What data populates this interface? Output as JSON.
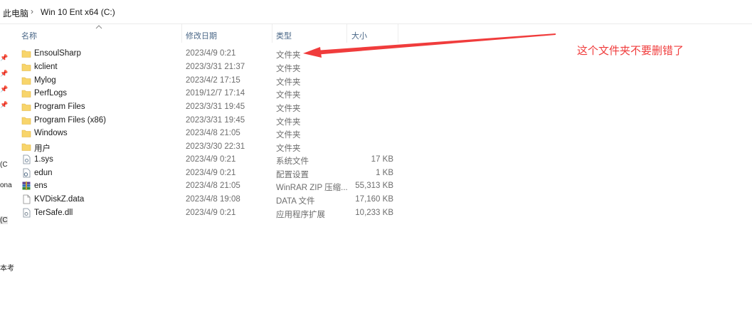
{
  "breadcrumb": {
    "root": "此电脑",
    "separator": "›",
    "current": "Win 10 Ent x64 (C:)"
  },
  "columns": {
    "name": "名称",
    "date": "修改日期",
    "type": "类型",
    "size": "大小"
  },
  "nav_fragments": [
    "(C",
    "ona",
    "(C",
    "本考"
  ],
  "files": [
    {
      "name": "EnsoulSharp",
      "date": "2023/4/9 0:21",
      "type": "文件夹",
      "size": "",
      "icon": "folder-icon"
    },
    {
      "name": "kclient",
      "date": "2023/3/31 21:37",
      "type": "文件夹",
      "size": "",
      "icon": "folder-icon"
    },
    {
      "name": "Mylog",
      "date": "2023/4/2 17:15",
      "type": "文件夹",
      "size": "",
      "icon": "folder-icon"
    },
    {
      "name": "PerfLogs",
      "date": "2019/12/7 17:14",
      "type": "文件夹",
      "size": "",
      "icon": "folder-icon"
    },
    {
      "name": "Program Files",
      "date": "2023/3/31 19:45",
      "type": "文件夹",
      "size": "",
      "icon": "folder-icon"
    },
    {
      "name": "Program Files (x86)",
      "date": "2023/3/31 19:45",
      "type": "文件夹",
      "size": "",
      "icon": "folder-icon"
    },
    {
      "name": "Windows",
      "date": "2023/4/8 21:05",
      "type": "文件夹",
      "size": "",
      "icon": "folder-icon"
    },
    {
      "name": "用户",
      "date": "2023/3/30 22:31",
      "type": "文件夹",
      "size": "",
      "icon": "folder-icon"
    },
    {
      "name": "1.sys",
      "date": "2023/4/9 0:21",
      "type": "系统文件",
      "size": "17 KB",
      "icon": "system-file-icon"
    },
    {
      "name": "edun",
      "date": "2023/4/9 0:21",
      "type": "配置设置",
      "size": "1 KB",
      "icon": "config-file-icon"
    },
    {
      "name": "ens",
      "date": "2023/4/8 21:05",
      "type": "WinRAR ZIP 压缩...",
      "size": "55,313 KB",
      "icon": "winrar-archive-icon"
    },
    {
      "name": "KVDiskZ.data",
      "date": "2023/4/8 19:08",
      "type": "DATA 文件",
      "size": "17,160 KB",
      "icon": "blank-file-icon"
    },
    {
      "name": "TerSafe.dll",
      "date": "2023/4/9 0:21",
      "type": "应用程序扩展",
      "size": "10,233 KB",
      "icon": "dll-file-icon"
    }
  ],
  "annotation": {
    "text": "这个文件夹不要删错了",
    "color": "#f03c3c"
  }
}
